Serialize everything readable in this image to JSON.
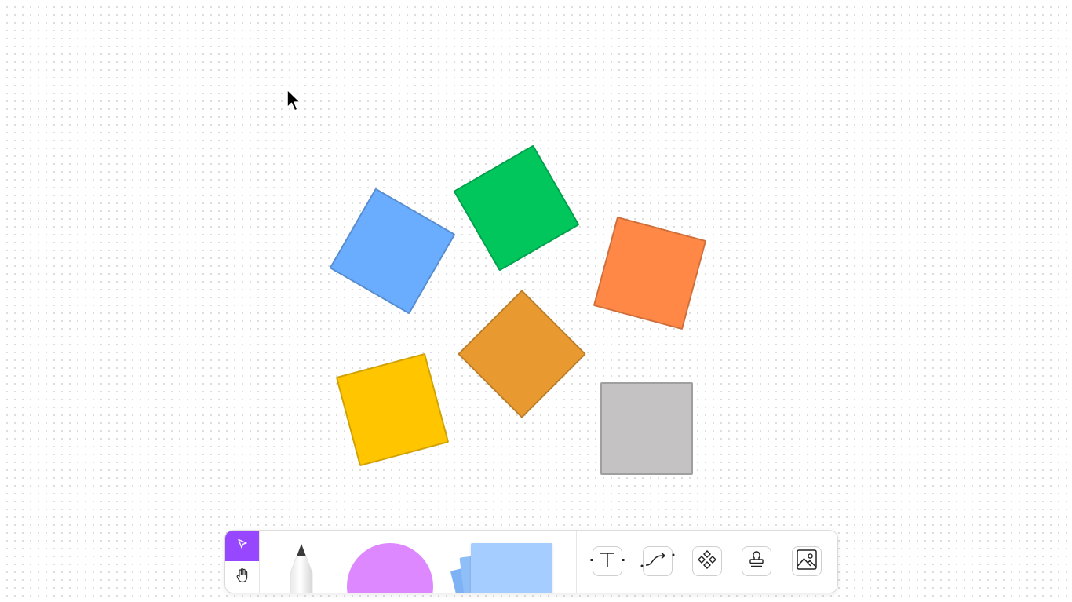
{
  "canvas": {
    "stickies": [
      {
        "name": "blue-sticky-note",
        "color": "#6aadff",
        "rotation": 30
      },
      {
        "name": "green-sticky-note",
        "color": "#00c65c",
        "rotation": -30
      },
      {
        "name": "orange-sticky-note",
        "color": "#ff8847",
        "rotation": 15
      },
      {
        "name": "amber-sticky-note",
        "color": "#e89a31",
        "rotation": 45
      },
      {
        "name": "yellow-sticky-note",
        "color": "#ffc600",
        "rotation": -15
      },
      {
        "name": "gray-sticky-note",
        "color": "#c4c2c3",
        "rotation": 0
      }
    ]
  },
  "toolbar": {
    "modes": [
      {
        "name": "select-mode",
        "icon": "cursor-icon",
        "active": true,
        "accent": "#9747ff"
      },
      {
        "name": "hand-mode",
        "icon": "hand-icon",
        "active": false
      }
    ],
    "tray": {
      "pencil": {
        "icon": "pencil-icon"
      },
      "shape": {
        "icon": "circle-shape-icon",
        "color": "#dd88ff"
      },
      "sticky": {
        "icon": "sticky-stack-icon",
        "color": "#a5cdff"
      }
    },
    "tools": [
      {
        "name": "text-tool",
        "icon": "text-icon"
      },
      {
        "name": "connector-tool",
        "icon": "connector-icon"
      },
      {
        "name": "component-tool",
        "icon": "component-icon"
      },
      {
        "name": "stamp-tool",
        "icon": "stamp-icon"
      },
      {
        "name": "image-tool",
        "icon": "image-icon"
      }
    ]
  }
}
